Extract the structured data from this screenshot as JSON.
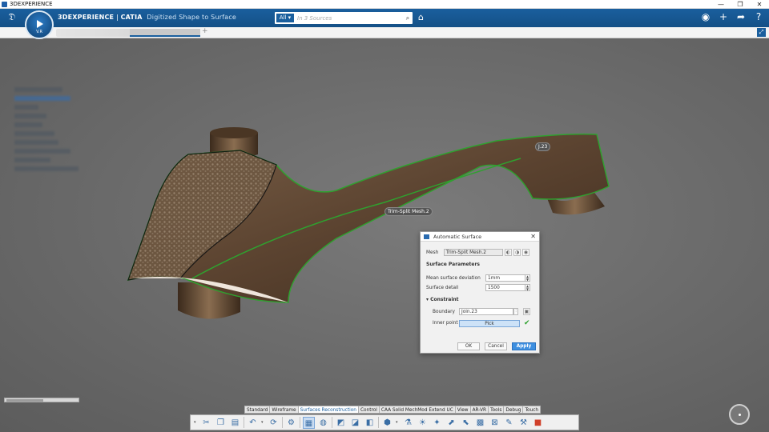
{
  "window": {
    "title": "3DEXPERIENCE",
    "controls": [
      "—",
      "❐",
      "✕"
    ]
  },
  "app": {
    "brand": "3DEXPERIENCE",
    "separator": " | ",
    "product": "CATIA",
    "app_name": "Digitized Shape to Surface",
    "compass_version": "V.R"
  },
  "search": {
    "scope": "All ▾",
    "placeholder": "In 3 Sources"
  },
  "tabs": {
    "add": "+"
  },
  "callouts": {
    "mesh_label": "Trim-Split Mesh.2",
    "boundary_tag": "J.23"
  },
  "dialog": {
    "title": "Automatic Surface",
    "mesh_label": "Mesh",
    "mesh_value": "Trim-Split Mesh.2",
    "surface_parameters": "Surface Parameters",
    "mean_dev_label": "Mean surface deviation",
    "mean_dev_value": "1mm",
    "surface_detail_label": "Surface detail",
    "surface_detail_value": "1500",
    "constraints": "▾ Constraint",
    "boundary_label": "Boundary",
    "boundary_value": "Join.23",
    "inner_point_label": "Inner point",
    "pick": "Pick",
    "ok": "OK",
    "cancel": "Cancel",
    "apply": "Apply"
  },
  "toolbar_tabs": [
    "Standard",
    "Wireframe",
    "Surfaces Reconstruction",
    "Control",
    "CAA Solid MechMod Extend UC",
    "View",
    "AR-VR",
    "Tools",
    "Debug",
    "Touch"
  ],
  "toolbar_tabs_active": 2,
  "colors": {
    "header_blue": "#1a5f9e",
    "model_brown": "#5e4630",
    "edge_green": "#2fa12f",
    "apply_blue": "#3d8fe0"
  }
}
